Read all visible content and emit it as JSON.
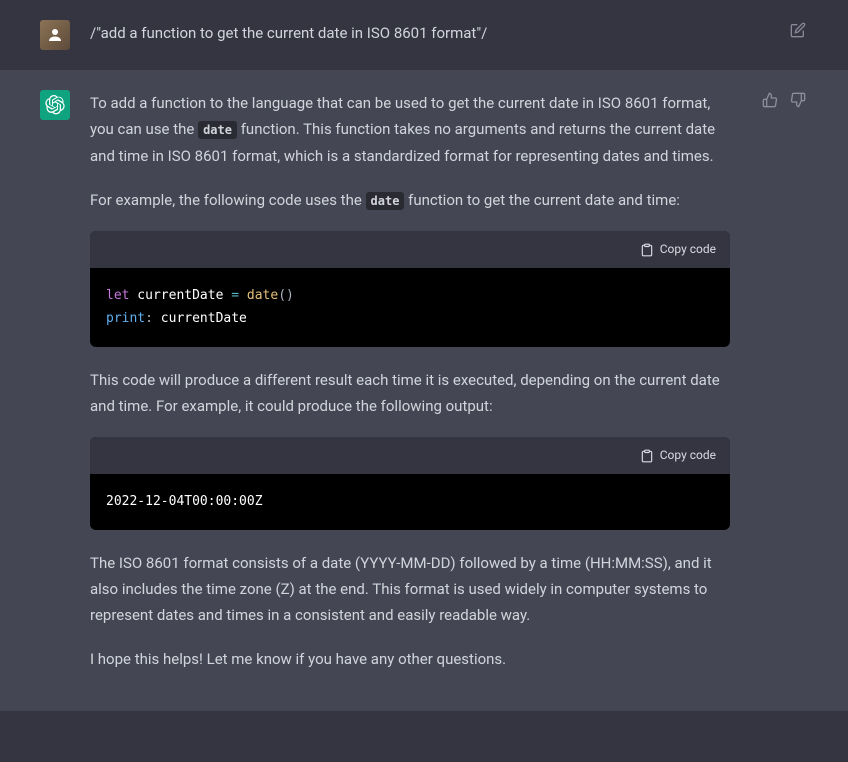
{
  "user": {
    "prompt": "/\"add a function to get the current date in ISO 8601 format\"/"
  },
  "assistant": {
    "p1_pre": "To add a function to the language that can be used to get the current date in ISO 8601 format, you can use the ",
    "p1_code": "date",
    "p1_post": " function. This function takes no arguments and returns the current date and time in ISO 8601 format, which is a standardized format for representing dates and times.",
    "p2_pre": "For example, the following code uses the ",
    "p2_code": "date",
    "p2_post": " function to get the current date and time:",
    "code1": {
      "copy_label": "Copy code",
      "l1_kw": "let",
      "l1_name": " currentDate ",
      "l1_op": "=",
      "l1_func": " date",
      "l1_paren": "()",
      "l2_call": "print",
      "l2_colon": ":",
      "l2_arg": " currentDate"
    },
    "p3": "This code will produce a different result each time it is executed, depending on the current date and time. For example, it could produce the following output:",
    "code2": {
      "copy_label": "Copy code",
      "output": "2022-12-04T00:00:00Z"
    },
    "p4": "The ISO 8601 format consists of a date (YYYY-MM-DD) followed by a time (HH:MM:SS), and it also includes the time zone (Z) at the end. This format is used widely in computer systems to represent dates and times in a consistent and easily readable way.",
    "p5": "I hope this helps! Let me know if you have any other questions."
  }
}
